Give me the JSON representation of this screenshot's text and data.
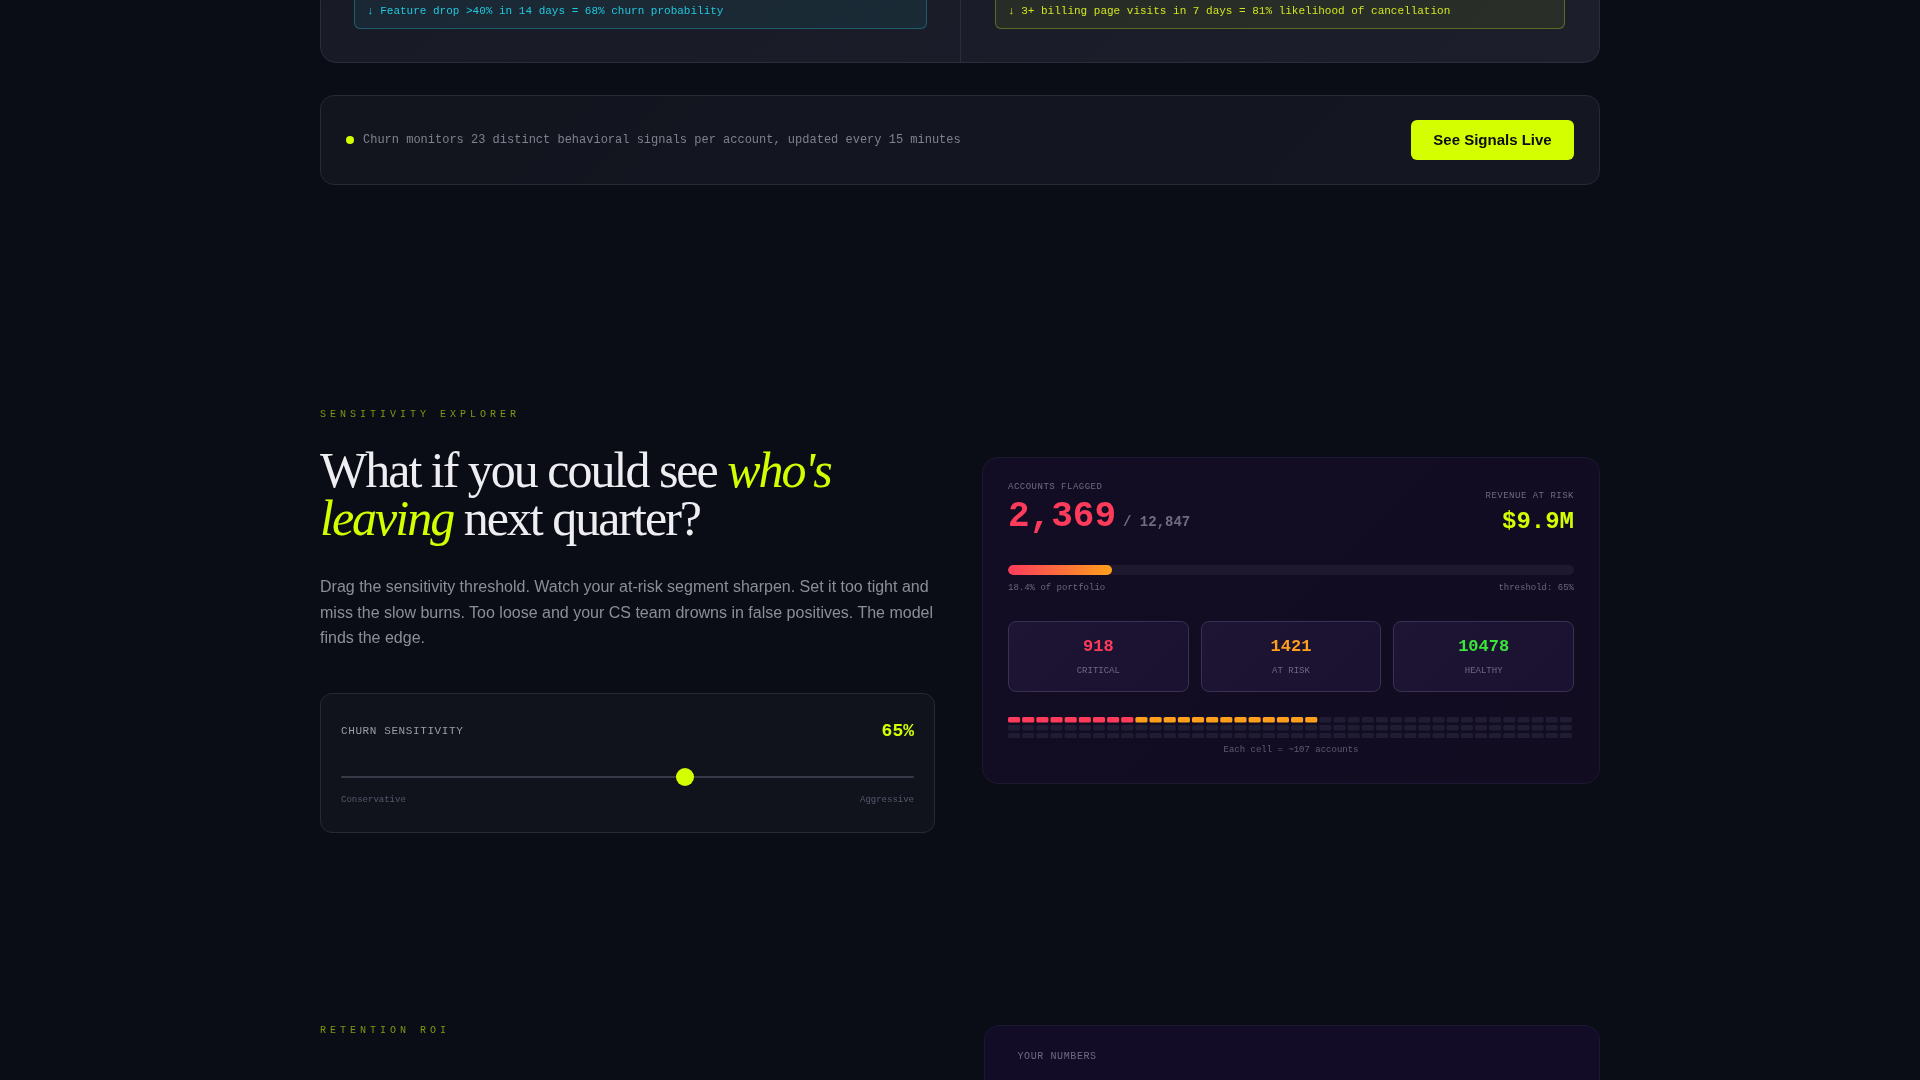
{
  "signal_rules": [
    {
      "text": "↓ Feature drop >40% in 14 days = 68% churn probability",
      "color": "#22c7dc"
    },
    {
      "text": "↓ 3+ billing page visits in 7 days = 81% likelihood of cancellation",
      "color": "#d1e41f"
    }
  ],
  "signals_banner": {
    "text": "Churn monitors 23 distinct behavioral signals per account, updated every 15 minutes",
    "button": "See Signals Live"
  },
  "sensitivity_explorer": {
    "eyebrow": "SENSITIVITY EXPLORER",
    "heading": "What if you could see *who's leaving* next quarter?",
    "description": "Drag the sensitivity threshold. Watch your at-risk segment sharpen. Set it too tight and miss the slow burns. Too loose and your CS team drowns in false positives. The model finds the edge.",
    "slider": {
      "label": "CHURN SENSITIVITY",
      "reading": "65%",
      "level": 0.6,
      "min_label": "Conservative",
      "max_label": "Aggressive"
    }
  },
  "accounts_panel": {
    "flagged_label": "ACCOUNTS FLAGGED",
    "flagged_count": "2,369",
    "total": "/ 12,847",
    "revenue_label": "REVENUE AT RISK",
    "revenue": "$9.9M",
    "portfolio": {
      "level": 0.184,
      "share": "18.4% of portfolio",
      "threshold": "threshold: 65%"
    },
    "tiers": [
      {
        "value": "918",
        "label": "CRITICAL",
        "color": "#ff3b5c",
        "flagged": true
      },
      {
        "value": "1421",
        "label": "AT RISK",
        "color": "#ff9f1c",
        "flagged": true
      },
      {
        "value": "10478",
        "label": "HEALTHY",
        "color": "#39e639",
        "flagged": false
      }
    ],
    "grid_caption": "Each cell = ~107 accounts"
  },
  "retention_roi": {
    "eyebrow": "RETENTION ROI",
    "panel_label": "YOUR NUMBERS"
  }
}
